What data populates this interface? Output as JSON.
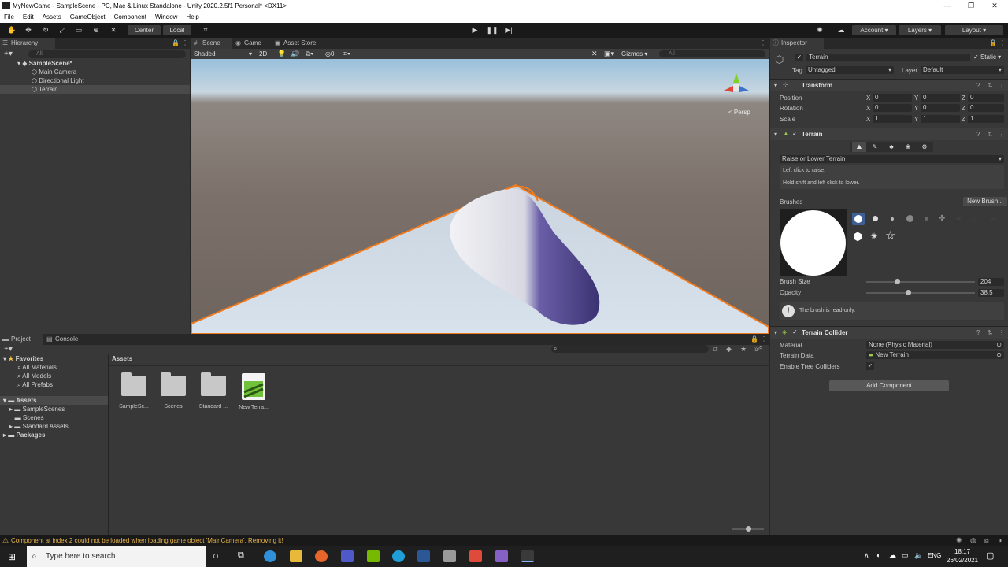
{
  "window": {
    "title": "MyNewGame - SampleScene - PC, Mac & Linux Standalone - Unity 2020.2.5f1 Personal* <DX11>",
    "minimize": "—",
    "maximize": "❐",
    "close": "✕"
  },
  "menu": [
    "File",
    "Edit",
    "Assets",
    "GameObject",
    "Component",
    "Window",
    "Help"
  ],
  "toolbar": {
    "center_label": "Center",
    "local_label": "Local",
    "account_label": "Account",
    "layers_label": "Layers",
    "layout_label": "Layout"
  },
  "hierarchy": {
    "tab_label": "Hierarchy",
    "search_placeholder": "All",
    "scene_name": "SampleScene*",
    "items": [
      "Main Camera",
      "Directional Light",
      "Terrain"
    ]
  },
  "scene": {
    "tabs": [
      "Scene",
      "Game",
      "Asset Store"
    ],
    "shading": "Shaded",
    "mode_2d": "2D",
    "fx_count": "0",
    "gizmos_label": "Gizmos",
    "search_placeholder": "All",
    "persp_label": "< Persp"
  },
  "inspector": {
    "tab_label": "Inspector",
    "object_name": "Terrain",
    "static_label": "Static",
    "tag_label": "Tag",
    "tag_value": "Untagged",
    "layer_label": "Layer",
    "layer_value": "Default",
    "transform": {
      "title": "Transform",
      "position_label": "Position",
      "rotation_label": "Rotation",
      "scale_label": "Scale",
      "position": {
        "x": "0",
        "y": "0",
        "z": "0"
      },
      "rotation": {
        "x": "0",
        "y": "0",
        "z": "0"
      },
      "scale": {
        "x": "1",
        "y": "1",
        "z": "1"
      },
      "axis_x": "X",
      "axis_y": "Y",
      "axis_z": "Z"
    },
    "terrain": {
      "title": "Terrain",
      "tool_dropdown": "Raise or Lower Terrain",
      "help_line1": "Left click to raise.",
      "help_line2": "Hold shift and left click to lower.",
      "brushes_label": "Brushes",
      "new_brush_button": "New Brush...",
      "brush_size_label": "Brush Size",
      "brush_size_value": "204",
      "brush_size_fraction": 0.28,
      "opacity_label": "Opacity",
      "opacity_value": "38.5",
      "opacity_fraction": 0.385,
      "readonly_notice": "The brush is read-only."
    },
    "collider": {
      "title": "Terrain Collider",
      "material_label": "Material",
      "material_value": "None (Physic Material)",
      "data_label": "Terrain Data",
      "data_value": "New Terrain",
      "trees_label": "Enable Tree Colliders"
    },
    "add_component_button": "Add Component"
  },
  "project": {
    "tabs": [
      "Project",
      "Console"
    ],
    "count_badge": "9",
    "favorites_label": "Favorites",
    "favorites": [
      "All Materials",
      "All Models",
      "All Prefabs"
    ],
    "assets_label": "Assets",
    "asset_folders": [
      "SampleScenes",
      "Scenes",
      "Standard Assets"
    ],
    "packages_label": "Packages",
    "breadcrumb": "Assets",
    "grid_items": [
      "SampleSc...",
      "Scenes",
      "Standard ...",
      "New Terra..."
    ]
  },
  "status": {
    "message": "Component at index 2 could not be loaded when loading game object 'MainCamera'. Removing it!"
  },
  "taskbar": {
    "search_placeholder": "Type here to search",
    "language": "ENG",
    "time": "18:17",
    "date": "26/02/2021"
  },
  "colors": {
    "accent_orange": "#f07a1e",
    "selection_blue": "#3e5f96",
    "panel": "#383838"
  }
}
